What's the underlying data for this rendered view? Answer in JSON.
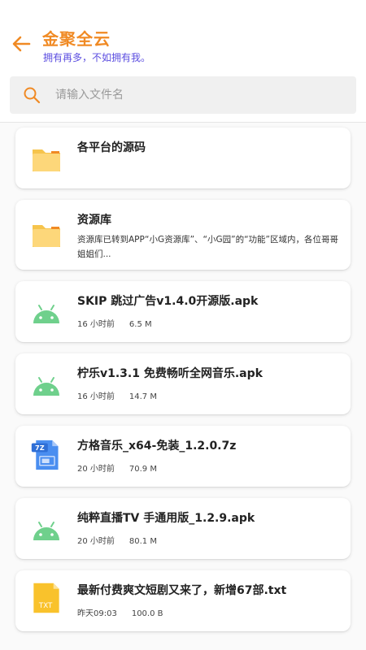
{
  "header": {
    "title": "金聚全云",
    "subtitle": "拥有再多，不如拥有我。"
  },
  "search": {
    "placeholder": "请输入文件名"
  },
  "files": [
    {
      "name": "各平台的源码",
      "type": "folder-icon"
    },
    {
      "name": "资源库",
      "type": "folder-icon",
      "desc": "资源库已转到APP“小G资源库”、“小G园”的“功能”区域内，各位哥哥姐姐们..."
    },
    {
      "name": "SKIP 跳过广告v1.4.0开源版.apk",
      "type": "android-icon",
      "time": "16 小时前",
      "size": "6.5 M"
    },
    {
      "name": "柠乐v1.3.1 免费畅听全网音乐.apk",
      "type": "android-icon",
      "time": "16 小时前",
      "size": "14.7 M"
    },
    {
      "name": "方格音乐_x64-免装_1.2.0.7z",
      "type": "7z-file-icon",
      "icon_text": "7Z",
      "time": "20 小时前",
      "size": "70.9 M"
    },
    {
      "name": "纯粹直播TV 手通用版_1.2.9.apk",
      "type": "android-icon",
      "time": "20 小时前",
      "size": "80.1 M"
    },
    {
      "name": "最新付费爽文短剧又来了，新增67部.txt",
      "type": "txt-file-icon",
      "icon_text": "TXT",
      "time": "昨天09:03",
      "size": "100.0 B"
    }
  ],
  "colors": {
    "accent": "#f08a24",
    "subtitle": "#5b4de0",
    "folder": "#fdd77a",
    "android": "#6fd08c",
    "file_7z": "#4a8ef0",
    "file_txt": "#f9c22c"
  }
}
